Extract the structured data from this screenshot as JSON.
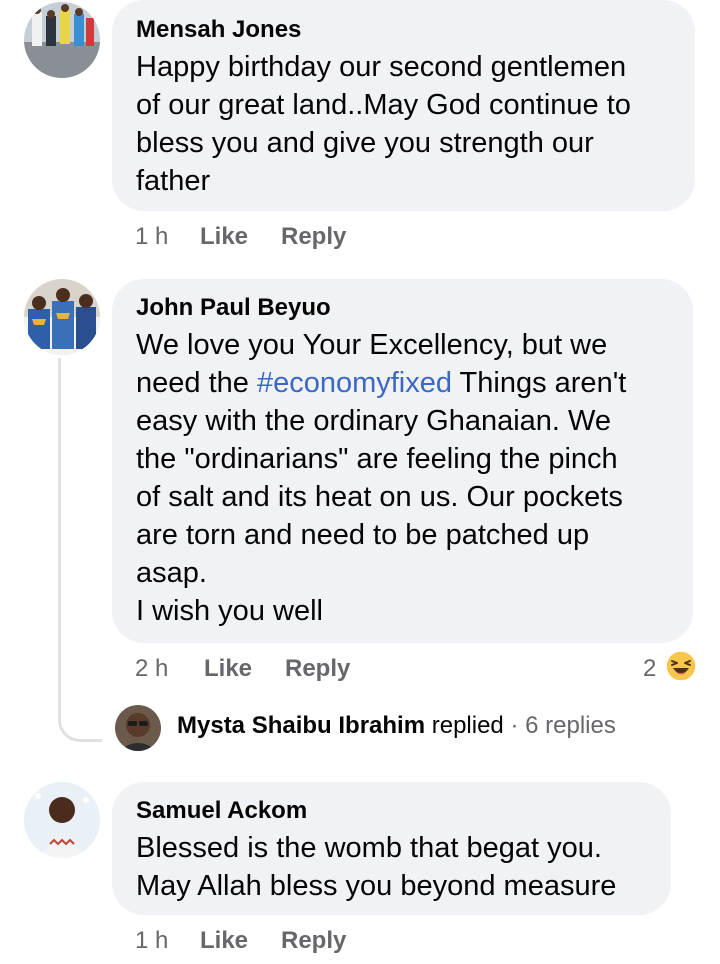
{
  "comments": [
    {
      "author": "Mensah Jones",
      "lines": [
        "Happy birthday our second gentlemen",
        "of our great land..May God continue to",
        "bless you and give you strength our",
        "father"
      ],
      "time": "1 h",
      "like_label": "Like",
      "reply_label": "Reply"
    },
    {
      "author": "John Paul Beyuo",
      "line1": "We love you Your Excellency, but we",
      "line2_pre": "need the ",
      "hashtag": "#economyfixed",
      "line2_post": " Things aren't",
      "lines_rest": [
        "easy with the ordinary Ghanaian. We",
        "the \"ordinarians\" are feeling the pinch",
        "of salt and its heat on us. Our pockets",
        "are torn and need to be patched up",
        "asap.",
        "I wish you well"
      ],
      "time": "2 h",
      "like_label": "Like",
      "reply_label": "Reply",
      "reaction_count": "2",
      "reaction_icon": "haha-emoji-icon",
      "replies": {
        "name": "Mysta Shaibu Ibrahim",
        "verb": "replied",
        "separator": "·",
        "count_label": "6 replies"
      }
    },
    {
      "author": "Samuel Ackom",
      "lines": [
        "Blessed is the womb that begat  you.",
        "May Allah bless you beyond measure"
      ],
      "time": "1 h",
      "like_label": "Like",
      "reply_label": "Reply"
    }
  ],
  "colors": {
    "bubble": "#f0f2f5",
    "meta": "#65676b",
    "hashtag": "#3a68c2",
    "text": "#050505"
  }
}
